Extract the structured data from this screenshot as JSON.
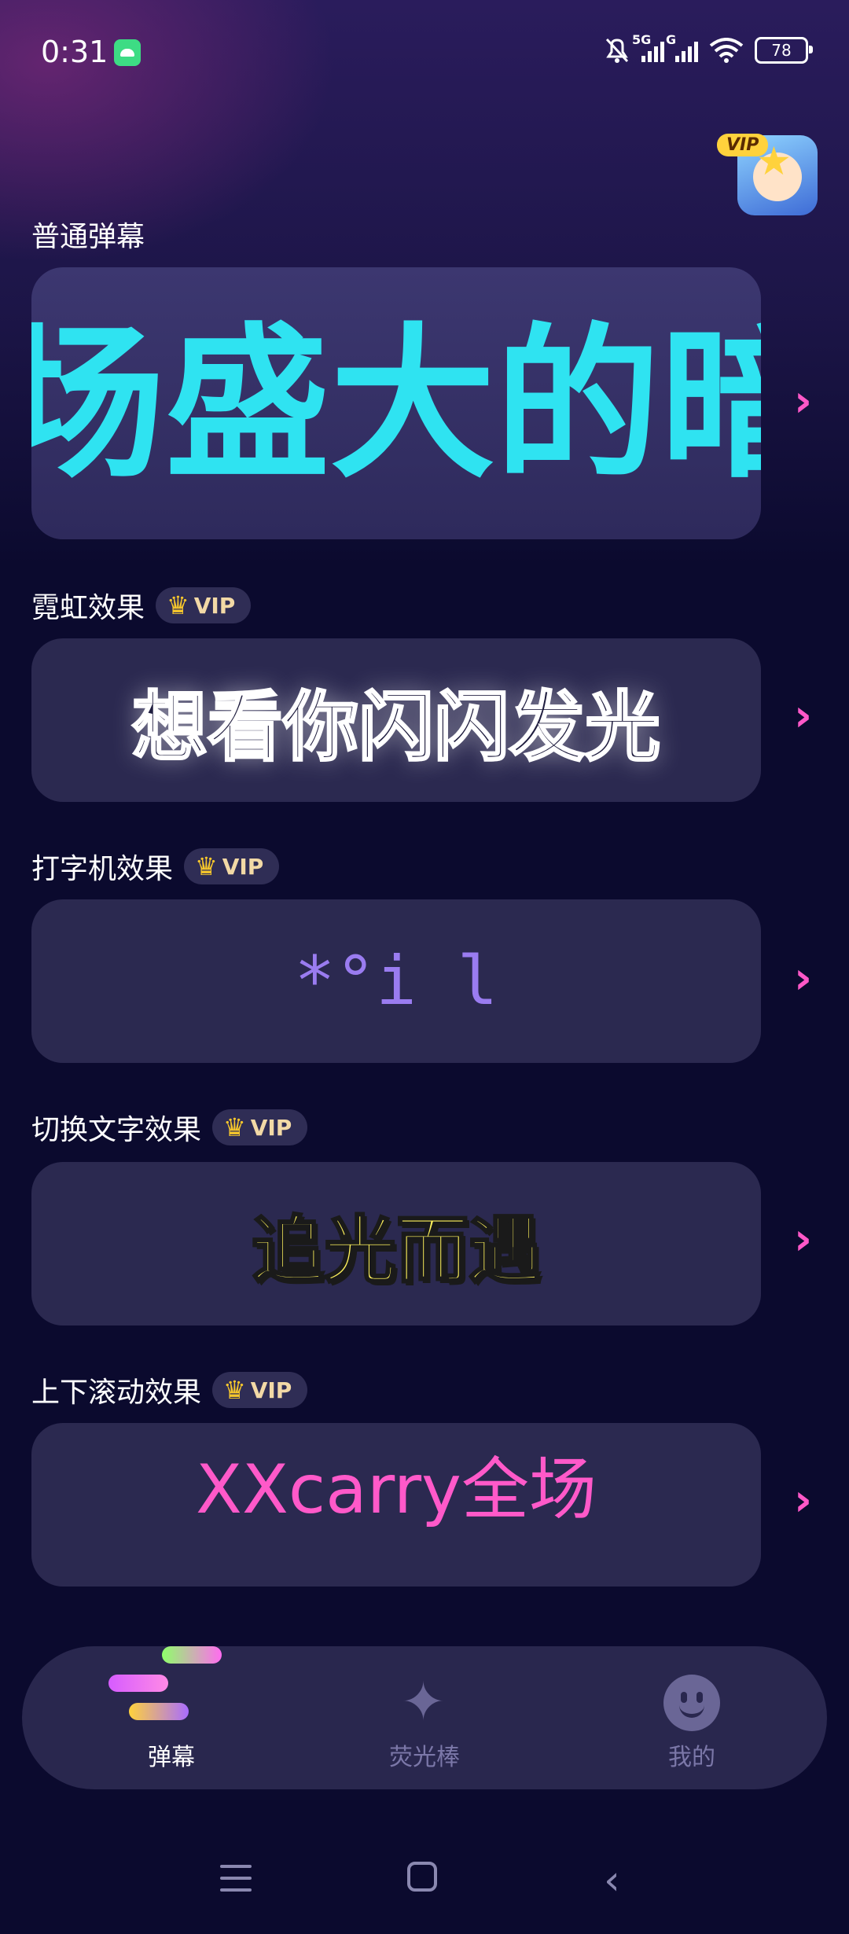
{
  "status_bar": {
    "time": "0:31",
    "network_1": "5G",
    "network_2": "G",
    "battery": "78"
  },
  "header": {
    "vip_badge": "VIP"
  },
  "sections": [
    {
      "title": "普通弹幕",
      "preview_text": "场盛大的暗",
      "color": "#2fe3f1"
    },
    {
      "title": "霓虹效果",
      "vip": "VIP",
      "preview_text": "想看你闪闪发光",
      "color": "#ffffff"
    },
    {
      "title": "打字机效果",
      "vip": "VIP",
      "preview_text": "*°i l",
      "color": "#9a7cf0"
    },
    {
      "title": "切换文字效果",
      "vip": "VIP",
      "preview_text": "追光而遇",
      "color": "#fff25c"
    },
    {
      "title": "上下滚动效果",
      "vip": "VIP",
      "preview_text": "XXcarry全场",
      "color": "#ff59c9"
    }
  ],
  "bottom_nav": {
    "items": [
      {
        "label": "弹幕",
        "icon": "danmaku-icon",
        "active": true
      },
      {
        "label": "荧光棒",
        "icon": "glowstick-icon",
        "active": false
      },
      {
        "label": "我的",
        "icon": "profile-smile-icon",
        "active": false
      }
    ]
  },
  "system_nav": [
    "menu-icon",
    "home-icon",
    "back-icon"
  ]
}
